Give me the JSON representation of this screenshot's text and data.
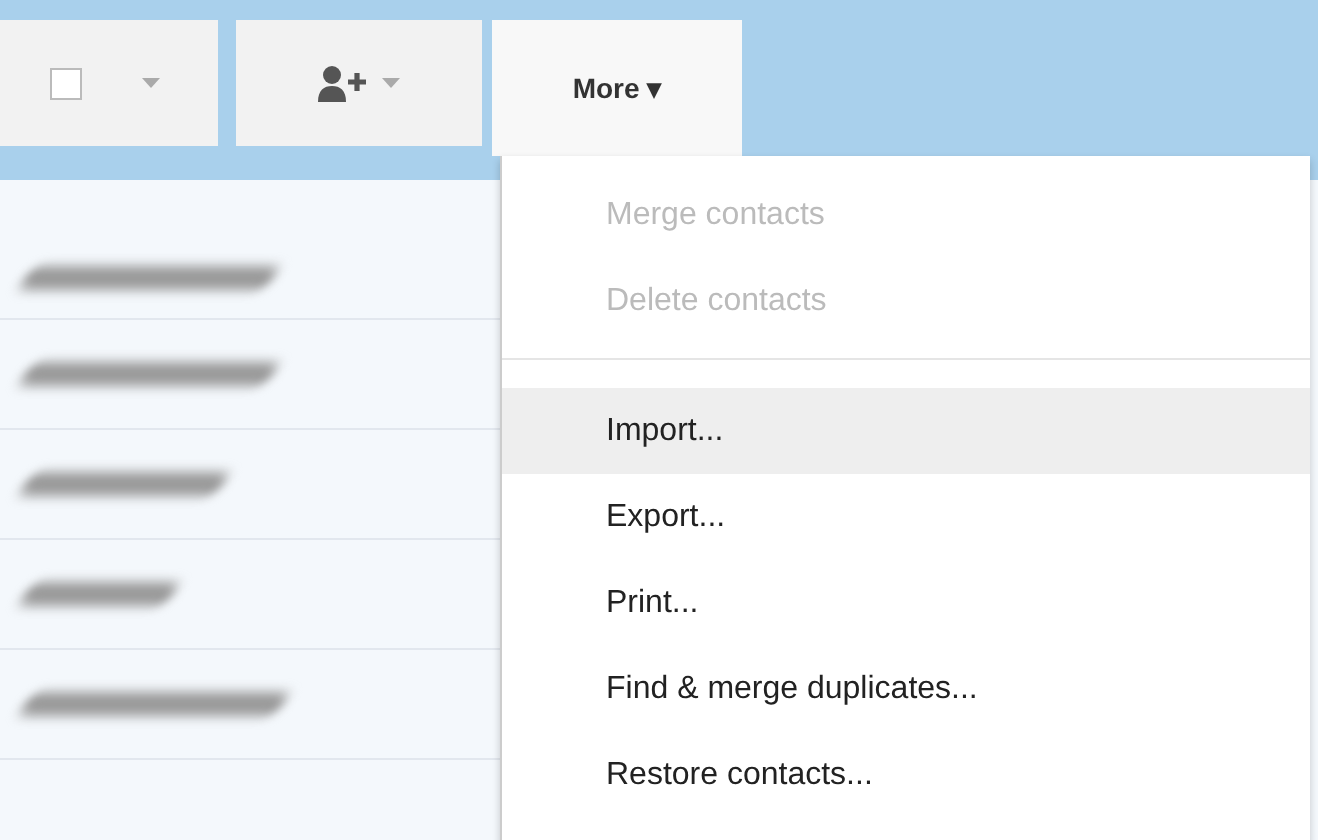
{
  "toolbar": {
    "select_checkbox": {
      "checked": false
    },
    "more_button": {
      "label": "More ▾",
      "expanded": true
    }
  },
  "more_menu": {
    "items": [
      {
        "kind": "item",
        "label": "Merge contacts",
        "disabled": true,
        "selected": false
      },
      {
        "kind": "item",
        "label": "Delete contacts",
        "disabled": true,
        "selected": false
      },
      {
        "kind": "divider"
      },
      {
        "kind": "item",
        "label": "Import...",
        "disabled": false,
        "selected": true
      },
      {
        "kind": "item",
        "label": "Export...",
        "disabled": false,
        "selected": false
      },
      {
        "kind": "item",
        "label": "Print...",
        "disabled": false,
        "selected": false
      },
      {
        "kind": "item",
        "label": "Find & merge duplicates...",
        "disabled": false,
        "selected": false
      },
      {
        "kind": "item",
        "label": "Restore contacts...",
        "disabled": false,
        "selected": false
      }
    ]
  }
}
